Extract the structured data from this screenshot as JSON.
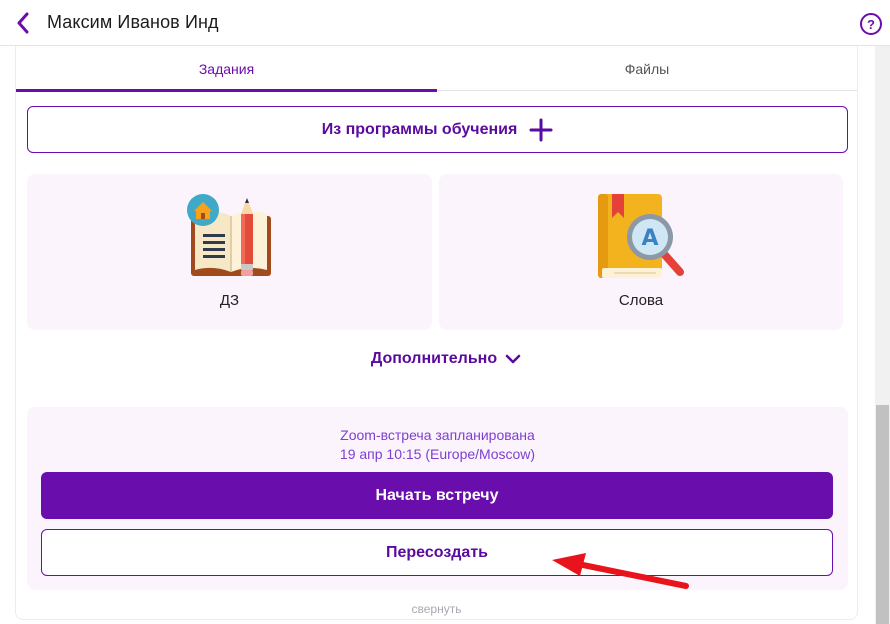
{
  "header": {
    "title": "Максим Иванов Инд",
    "help_symbol": "?"
  },
  "tabs": [
    {
      "label": "Задания",
      "active": true
    },
    {
      "label": "Файлы",
      "active": false
    }
  ],
  "program_button": {
    "label": "Из программы обучения"
  },
  "tiles": [
    {
      "label": "ДЗ",
      "icon": "homework-book-icon"
    },
    {
      "label": "Слова",
      "icon": "dictionary-search-icon"
    }
  ],
  "more": {
    "label": "Дополнительно"
  },
  "zoom": {
    "status": "Zoom-встреча запланирована",
    "time": "19 апр 10:15 (Europe/Moscow)",
    "start_label": "Начать встречу",
    "recreate_label": "Пересоздать"
  },
  "collapse_label": "свернуть",
  "colors": {
    "accent": "#6a0dad",
    "tile_bg": "#fcf4fc",
    "annotation_arrow": "#e8131b"
  }
}
